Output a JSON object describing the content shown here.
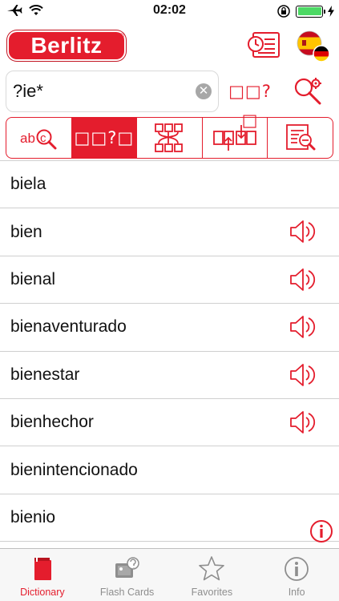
{
  "status_bar": {
    "time": "02:02",
    "battery_level": 1.0,
    "battery_color": "#4cd964"
  },
  "header": {
    "logo_text": "Berlitz",
    "logo_mark": "®",
    "history_icon": "history-list-icon",
    "language_icon": "spanish-german-flags-icon"
  },
  "search": {
    "value": "?ie*",
    "clear_icon": "clear-icon",
    "pattern_label": "□□?□",
    "settings_icon": "search-settings-icon"
  },
  "modes": [
    {
      "id": "spelling",
      "label": "abc",
      "icon": "spellcheck-search-icon",
      "active": false
    },
    {
      "id": "wildcard",
      "label": "□□?□",
      "icon": "wildcard-icon",
      "active": true
    },
    {
      "id": "anagram",
      "label": "",
      "icon": "anagram-icon",
      "active": false
    },
    {
      "id": "word-builder",
      "label": "",
      "icon": "word-builder-icon",
      "active": false
    },
    {
      "id": "fulltext",
      "label": "",
      "icon": "fulltext-search-icon",
      "active": false
    }
  ],
  "words": [
    {
      "text": "biela",
      "audio": false
    },
    {
      "text": "bien",
      "audio": true
    },
    {
      "text": "bienal",
      "audio": true
    },
    {
      "text": "bienaventurado",
      "audio": true
    },
    {
      "text": "bienestar",
      "audio": true
    },
    {
      "text": "bienhechor",
      "audio": true
    },
    {
      "text": "bienintencionado",
      "audio": false
    },
    {
      "text": "bienio",
      "audio": false
    }
  ],
  "tabs": [
    {
      "label": "Dictionary",
      "icon": "book-icon",
      "active": true
    },
    {
      "label": "Flash Cards",
      "icon": "flash-cards-icon",
      "active": false
    },
    {
      "label": "Favorites",
      "icon": "star-icon",
      "active": false
    },
    {
      "label": "Info",
      "icon": "info-icon",
      "active": false
    }
  ],
  "colors": {
    "accent": "#e41d2d",
    "tab_inactive": "#8e8e8e",
    "divider": "#cfcfcf"
  }
}
